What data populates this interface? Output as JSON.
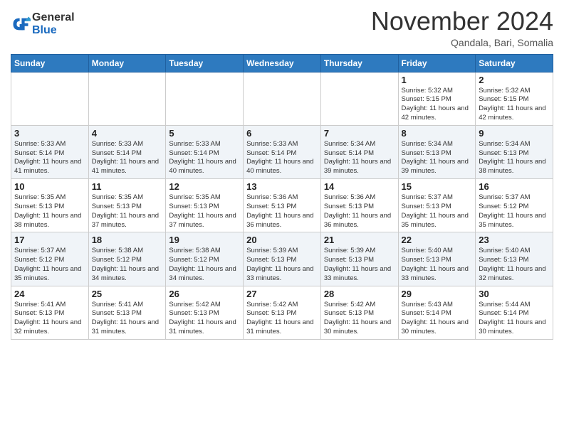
{
  "header": {
    "logo": {
      "general": "General",
      "blue": "Blue"
    },
    "title": "November 2024",
    "location": "Qandala, Bari, Somalia"
  },
  "weekdays": [
    "Sunday",
    "Monday",
    "Tuesday",
    "Wednesday",
    "Thursday",
    "Friday",
    "Saturday"
  ],
  "rows": [
    [
      {
        "day": "",
        "info": ""
      },
      {
        "day": "",
        "info": ""
      },
      {
        "day": "",
        "info": ""
      },
      {
        "day": "",
        "info": ""
      },
      {
        "day": "",
        "info": ""
      },
      {
        "day": "1",
        "info": "Sunrise: 5:32 AM\nSunset: 5:15 PM\nDaylight: 11 hours and 42 minutes."
      },
      {
        "day": "2",
        "info": "Sunrise: 5:32 AM\nSunset: 5:15 PM\nDaylight: 11 hours and 42 minutes."
      }
    ],
    [
      {
        "day": "3",
        "info": "Sunrise: 5:33 AM\nSunset: 5:14 PM\nDaylight: 11 hours and 41 minutes."
      },
      {
        "day": "4",
        "info": "Sunrise: 5:33 AM\nSunset: 5:14 PM\nDaylight: 11 hours and 41 minutes."
      },
      {
        "day": "5",
        "info": "Sunrise: 5:33 AM\nSunset: 5:14 PM\nDaylight: 11 hours and 40 minutes."
      },
      {
        "day": "6",
        "info": "Sunrise: 5:33 AM\nSunset: 5:14 PM\nDaylight: 11 hours and 40 minutes."
      },
      {
        "day": "7",
        "info": "Sunrise: 5:34 AM\nSunset: 5:14 PM\nDaylight: 11 hours and 39 minutes."
      },
      {
        "day": "8",
        "info": "Sunrise: 5:34 AM\nSunset: 5:13 PM\nDaylight: 11 hours and 39 minutes."
      },
      {
        "day": "9",
        "info": "Sunrise: 5:34 AM\nSunset: 5:13 PM\nDaylight: 11 hours and 38 minutes."
      }
    ],
    [
      {
        "day": "10",
        "info": "Sunrise: 5:35 AM\nSunset: 5:13 PM\nDaylight: 11 hours and 38 minutes."
      },
      {
        "day": "11",
        "info": "Sunrise: 5:35 AM\nSunset: 5:13 PM\nDaylight: 11 hours and 37 minutes."
      },
      {
        "day": "12",
        "info": "Sunrise: 5:35 AM\nSunset: 5:13 PM\nDaylight: 11 hours and 37 minutes."
      },
      {
        "day": "13",
        "info": "Sunrise: 5:36 AM\nSunset: 5:13 PM\nDaylight: 11 hours and 36 minutes."
      },
      {
        "day": "14",
        "info": "Sunrise: 5:36 AM\nSunset: 5:13 PM\nDaylight: 11 hours and 36 minutes."
      },
      {
        "day": "15",
        "info": "Sunrise: 5:37 AM\nSunset: 5:13 PM\nDaylight: 11 hours and 35 minutes."
      },
      {
        "day": "16",
        "info": "Sunrise: 5:37 AM\nSunset: 5:12 PM\nDaylight: 11 hours and 35 minutes."
      }
    ],
    [
      {
        "day": "17",
        "info": "Sunrise: 5:37 AM\nSunset: 5:12 PM\nDaylight: 11 hours and 35 minutes."
      },
      {
        "day": "18",
        "info": "Sunrise: 5:38 AM\nSunset: 5:12 PM\nDaylight: 11 hours and 34 minutes."
      },
      {
        "day": "19",
        "info": "Sunrise: 5:38 AM\nSunset: 5:12 PM\nDaylight: 11 hours and 34 minutes."
      },
      {
        "day": "20",
        "info": "Sunrise: 5:39 AM\nSunset: 5:13 PM\nDaylight: 11 hours and 33 minutes."
      },
      {
        "day": "21",
        "info": "Sunrise: 5:39 AM\nSunset: 5:13 PM\nDaylight: 11 hours and 33 minutes."
      },
      {
        "day": "22",
        "info": "Sunrise: 5:40 AM\nSunset: 5:13 PM\nDaylight: 11 hours and 33 minutes."
      },
      {
        "day": "23",
        "info": "Sunrise: 5:40 AM\nSunset: 5:13 PM\nDaylight: 11 hours and 32 minutes."
      }
    ],
    [
      {
        "day": "24",
        "info": "Sunrise: 5:41 AM\nSunset: 5:13 PM\nDaylight: 11 hours and 32 minutes."
      },
      {
        "day": "25",
        "info": "Sunrise: 5:41 AM\nSunset: 5:13 PM\nDaylight: 11 hours and 31 minutes."
      },
      {
        "day": "26",
        "info": "Sunrise: 5:42 AM\nSunset: 5:13 PM\nDaylight: 11 hours and 31 minutes."
      },
      {
        "day": "27",
        "info": "Sunrise: 5:42 AM\nSunset: 5:13 PM\nDaylight: 11 hours and 31 minutes."
      },
      {
        "day": "28",
        "info": "Sunrise: 5:42 AM\nSunset: 5:13 PM\nDaylight: 11 hours and 30 minutes."
      },
      {
        "day": "29",
        "info": "Sunrise: 5:43 AM\nSunset: 5:14 PM\nDaylight: 11 hours and 30 minutes."
      },
      {
        "day": "30",
        "info": "Sunrise: 5:44 AM\nSunset: 5:14 PM\nDaylight: 11 hours and 30 minutes."
      }
    ]
  ]
}
